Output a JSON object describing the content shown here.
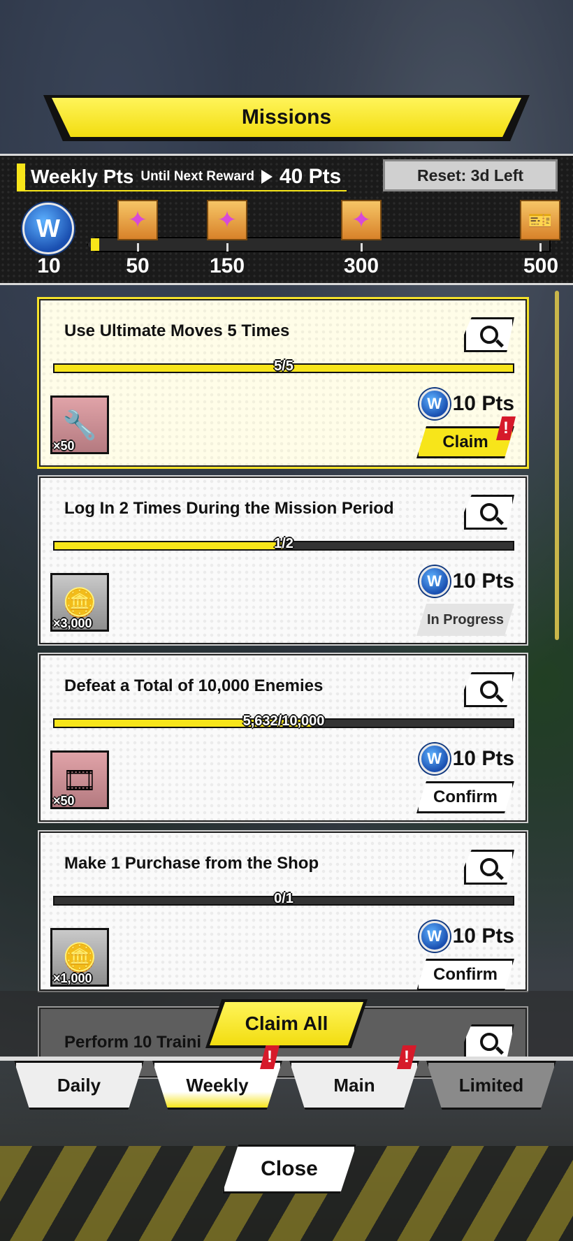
{
  "header": {
    "title": "Missions"
  },
  "weekly": {
    "title": "Weekly Pts",
    "until_label": "Until Next Reward",
    "points_needed": "40 Pts",
    "reset": "Reset: 3d Left",
    "current_points": "10",
    "badge_letter": "W",
    "milestones": [
      "50",
      "150",
      "300",
      "500"
    ]
  },
  "missions": [
    {
      "title": "Use Ultimate Moves 5 Times",
      "progress": "5/5",
      "progress_fraction": 1.0,
      "reward_qty": "×50",
      "reward_icon": "wrench-icon",
      "points": "10 Pts",
      "action": "Claim"
    },
    {
      "title": "Log In 2 Times During the Mission Period",
      "progress": "1/2",
      "progress_fraction": 0.5,
      "reward_qty": "×3,000",
      "reward_icon": "gold-coin-icon",
      "points": "10 Pts",
      "action": "In Progress"
    },
    {
      "title": "Defeat a Total of 10,000 Enemies",
      "progress": "5,632/10,000",
      "progress_fraction": 0.5632,
      "reward_qty": "×50",
      "reward_icon": "film-roll-icon",
      "points": "10 Pts",
      "action": "Confirm"
    },
    {
      "title": "Make 1 Purchase from the Shop",
      "progress": "0/1",
      "progress_fraction": 0.0,
      "reward_qty": "×1,000",
      "reward_icon": "gold-coin-icon",
      "points": "10 Pts",
      "action": "Confirm"
    },
    {
      "title": "Perform 10 Traini"
    }
  ],
  "footer": {
    "claim_all": "Claim All",
    "tabs": [
      "Daily",
      "Weekly",
      "Main",
      "Limited"
    ],
    "close": "Close"
  },
  "colors": {
    "accent": "#f7e51a",
    "badge_blue": "#1a4fb0",
    "alert": "#d61a2a"
  }
}
